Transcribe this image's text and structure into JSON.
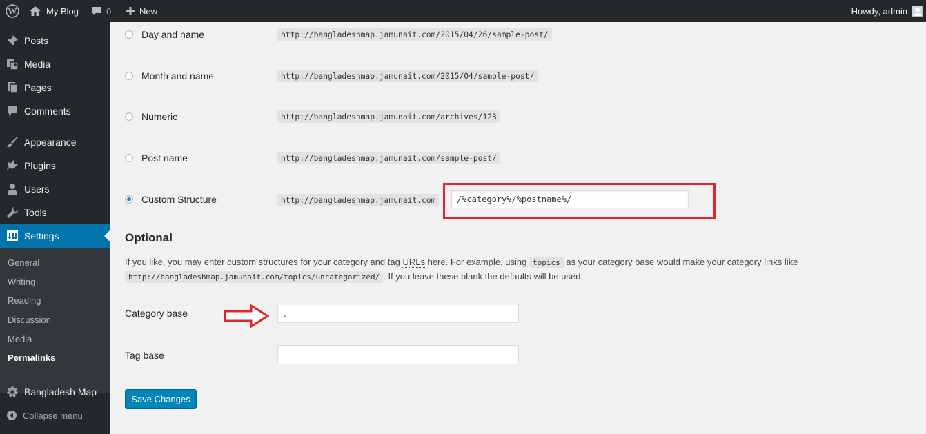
{
  "adminbar": {
    "site_name": "My Blog",
    "comments_count": "0",
    "new_label": "New",
    "howdy": "Howdy, admin"
  },
  "sidebar": {
    "items": [
      {
        "label": "Posts",
        "icon": "pin-icon"
      },
      {
        "label": "Media",
        "icon": "media-icon"
      },
      {
        "label": "Pages",
        "icon": "pages-icon"
      },
      {
        "label": "Comments",
        "icon": "comment-icon"
      },
      {
        "label": "Appearance",
        "icon": "brush-icon"
      },
      {
        "label": "Plugins",
        "icon": "plugin-icon"
      },
      {
        "label": "Users",
        "icon": "user-icon"
      },
      {
        "label": "Tools",
        "icon": "wrench-icon"
      },
      {
        "label": "Settings",
        "icon": "settings-icon"
      }
    ],
    "submenu": [
      "General",
      "Writing",
      "Reading",
      "Discussion",
      "Media",
      "Permalinks"
    ],
    "extra_item": "Bangladesh Map",
    "collapse": "Collapse menu"
  },
  "permalinks": {
    "options": [
      {
        "label": "Day and name",
        "example": "http://bangladeshmap.jamunait.com/2015/04/26/sample-post/"
      },
      {
        "label": "Month and name",
        "example": "http://bangladeshmap.jamunait.com/2015/04/sample-post/"
      },
      {
        "label": "Numeric",
        "example": "http://bangladeshmap.jamunait.com/archives/123"
      },
      {
        "label": "Post name",
        "example": "http://bangladeshmap.jamunait.com/sample-post/"
      },
      {
        "label": "Custom Structure",
        "example": "http://bangladeshmap.jamunait.com"
      }
    ],
    "selected": "Custom Structure",
    "custom_value": "/%category%/%postname%/"
  },
  "optional": {
    "heading": "Optional",
    "desc_1": "If you like, you may enter custom structures for your category and tag ",
    "desc_urls": "URLs",
    "desc_2": " here. For example, using ",
    "desc_code_1": "topics",
    "desc_3": " as your category base would make your category links like",
    "desc_code_2": "http://bangladeshmap.jamunait.com/topics/uncategorized/",
    "desc_4": ". If you leave these blank the defaults will be used.",
    "category_base_label": "Category base",
    "category_base_value": ".",
    "tag_base_label": "Tag base",
    "tag_base_value": ""
  },
  "save_label": "Save Changes",
  "colors": {
    "accent": "#0073aa",
    "highlight": "#e0262c"
  }
}
